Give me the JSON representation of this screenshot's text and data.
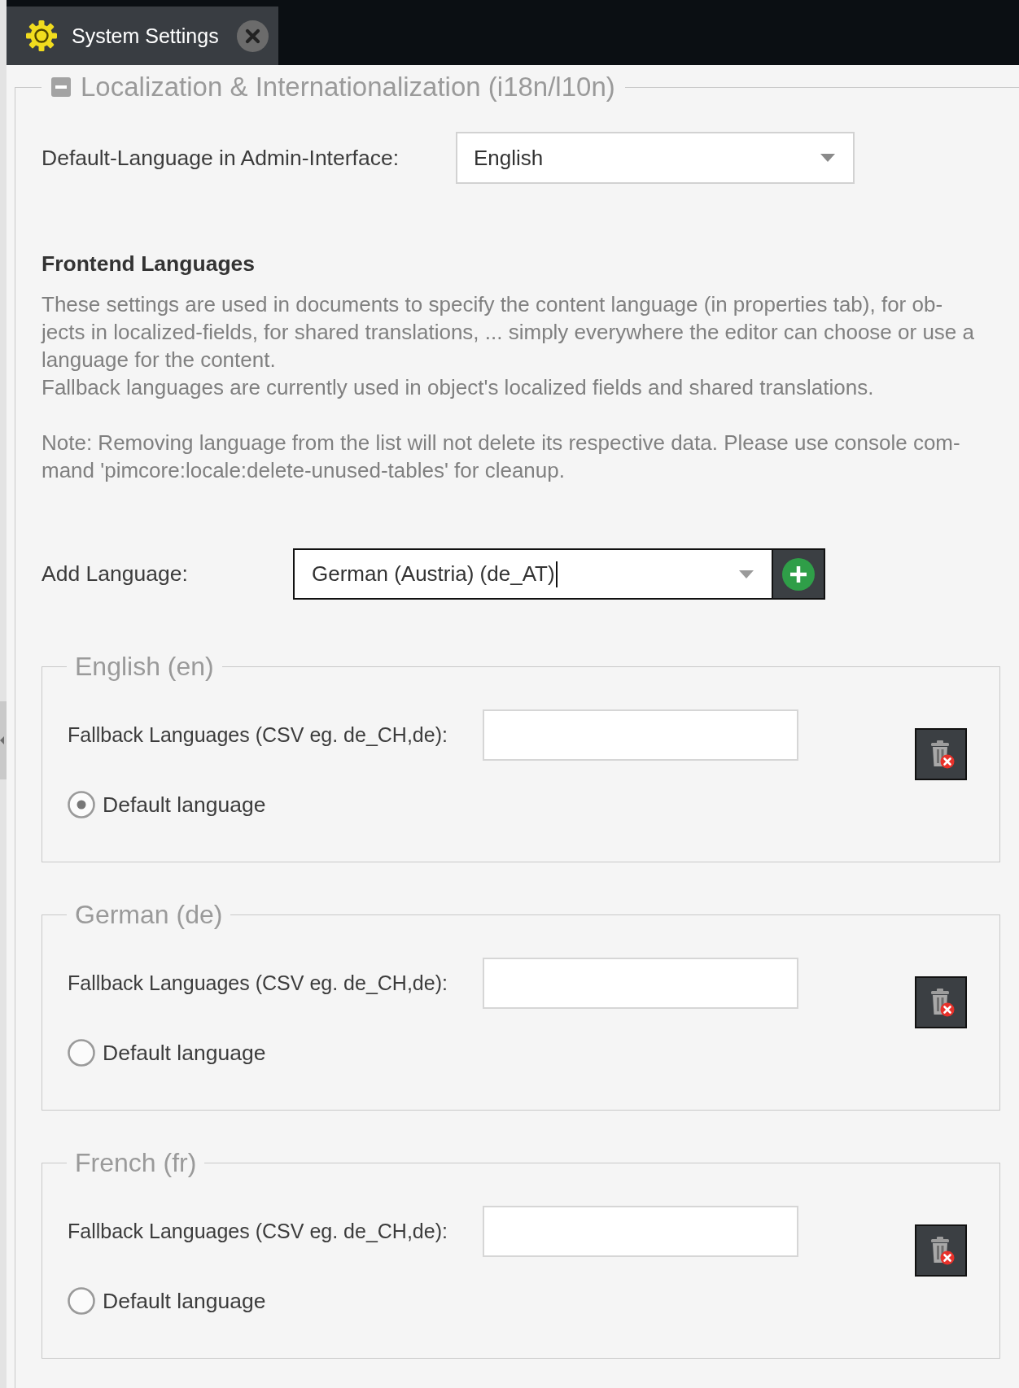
{
  "tabs": [
    {
      "label": "System Settings",
      "selected": true
    }
  ],
  "section": {
    "title": "Localization & Internationalization (i18n/l10n)",
    "expanded": true
  },
  "admin_language": {
    "label": "Default-Language in Admin-Interface:",
    "value": "English"
  },
  "frontend_languages": {
    "heading": "Frontend Languages",
    "description": "These settings are used in documents to specify the content language (in properties tab), for ob-\njects in localized-fields, for shared translations, ... simply everywhere the editor can choose or use a\nlanguage for the content.",
    "fallback_info": "Fallback languages are currently used in object's localized fields and shared translations.",
    "note": "Note: Removing language from the list will not delete its respective data. Please use console com-\nmand 'pimcore:locale:delete-unused-tables' for cleanup."
  },
  "add_language": {
    "label": "Add Language:",
    "value": "German (Austria) (de_AT)",
    "focused": true
  },
  "languages": [
    {
      "title": "English (en)",
      "fallback_label": "Fallback Languages (CSV eg. de_CH,de):",
      "default_label": "Default language",
      "selected": true
    },
    {
      "title": "German (de)",
      "fallback_label": "Fallback Languages (CSV eg. de_CH,de):",
      "default_label": "Default language",
      "selected": false
    },
    {
      "title": "French (fr)",
      "fallback_label": "Fallback Languages (CSV eg. de_CH,de):",
      "default_label": "Default language",
      "selected": false
    }
  ]
}
